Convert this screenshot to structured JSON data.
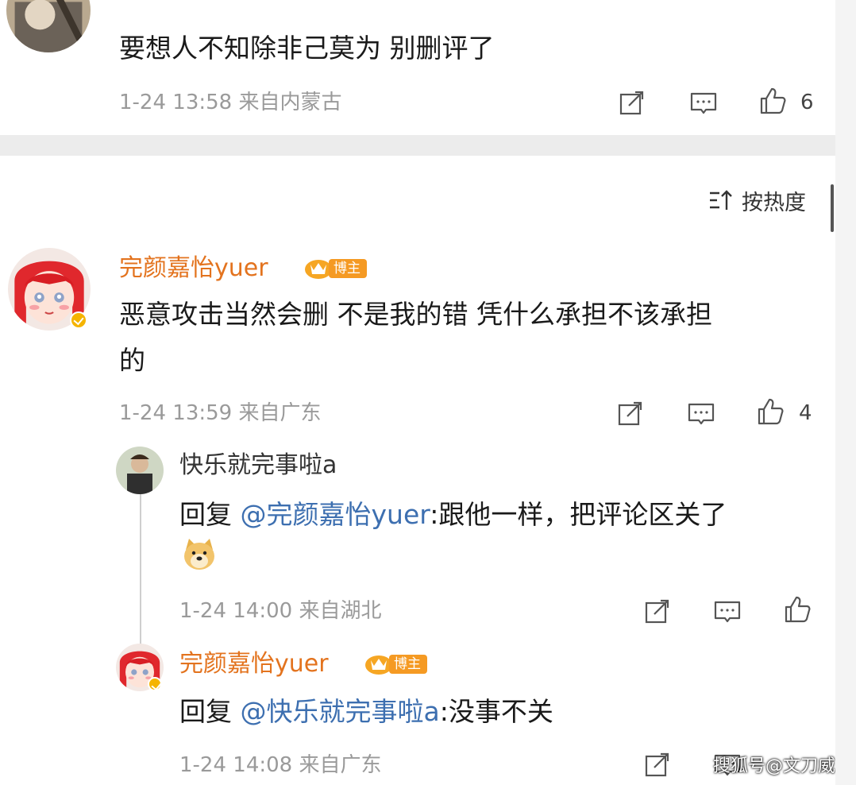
{
  "top_comment": {
    "text": "要想人不知除非己莫为 别删评了",
    "meta": "1-24 13:58 来自内蒙古",
    "likes": "6"
  },
  "sort": {
    "label": "按热度",
    "icon": "sort-icon"
  },
  "comments": [
    {
      "user": "完颜嘉怡yuer",
      "badge": "博主",
      "text_line1": "恶意攻击当然会删 不是我的错 凭什么承担不该承担",
      "text_line2": "的",
      "meta": "1-24 13:59 来自广东",
      "likes": "4"
    }
  ],
  "replies": [
    {
      "user": "快乐就完事啦a",
      "prefix": "回复 ",
      "mention": "@完颜嘉怡yuer",
      "body": ":跟他一样，把评论区关了",
      "emoji": "doge-emoji",
      "meta": "1-24 14:00 来自湖北"
    },
    {
      "user": "完颜嘉怡yuer",
      "badge": "博主",
      "prefix": "回复 ",
      "mention": "@快乐就完事啦a",
      "body": ":没事不关",
      "meta": "1-24 14:08 来自广东"
    }
  ],
  "watermark": "搜狐号@文刀威",
  "colors": {
    "author_name": "#e3731e",
    "mention": "#3d6fb0",
    "badge": "#f59a23",
    "meta": "#9a9a9a"
  }
}
